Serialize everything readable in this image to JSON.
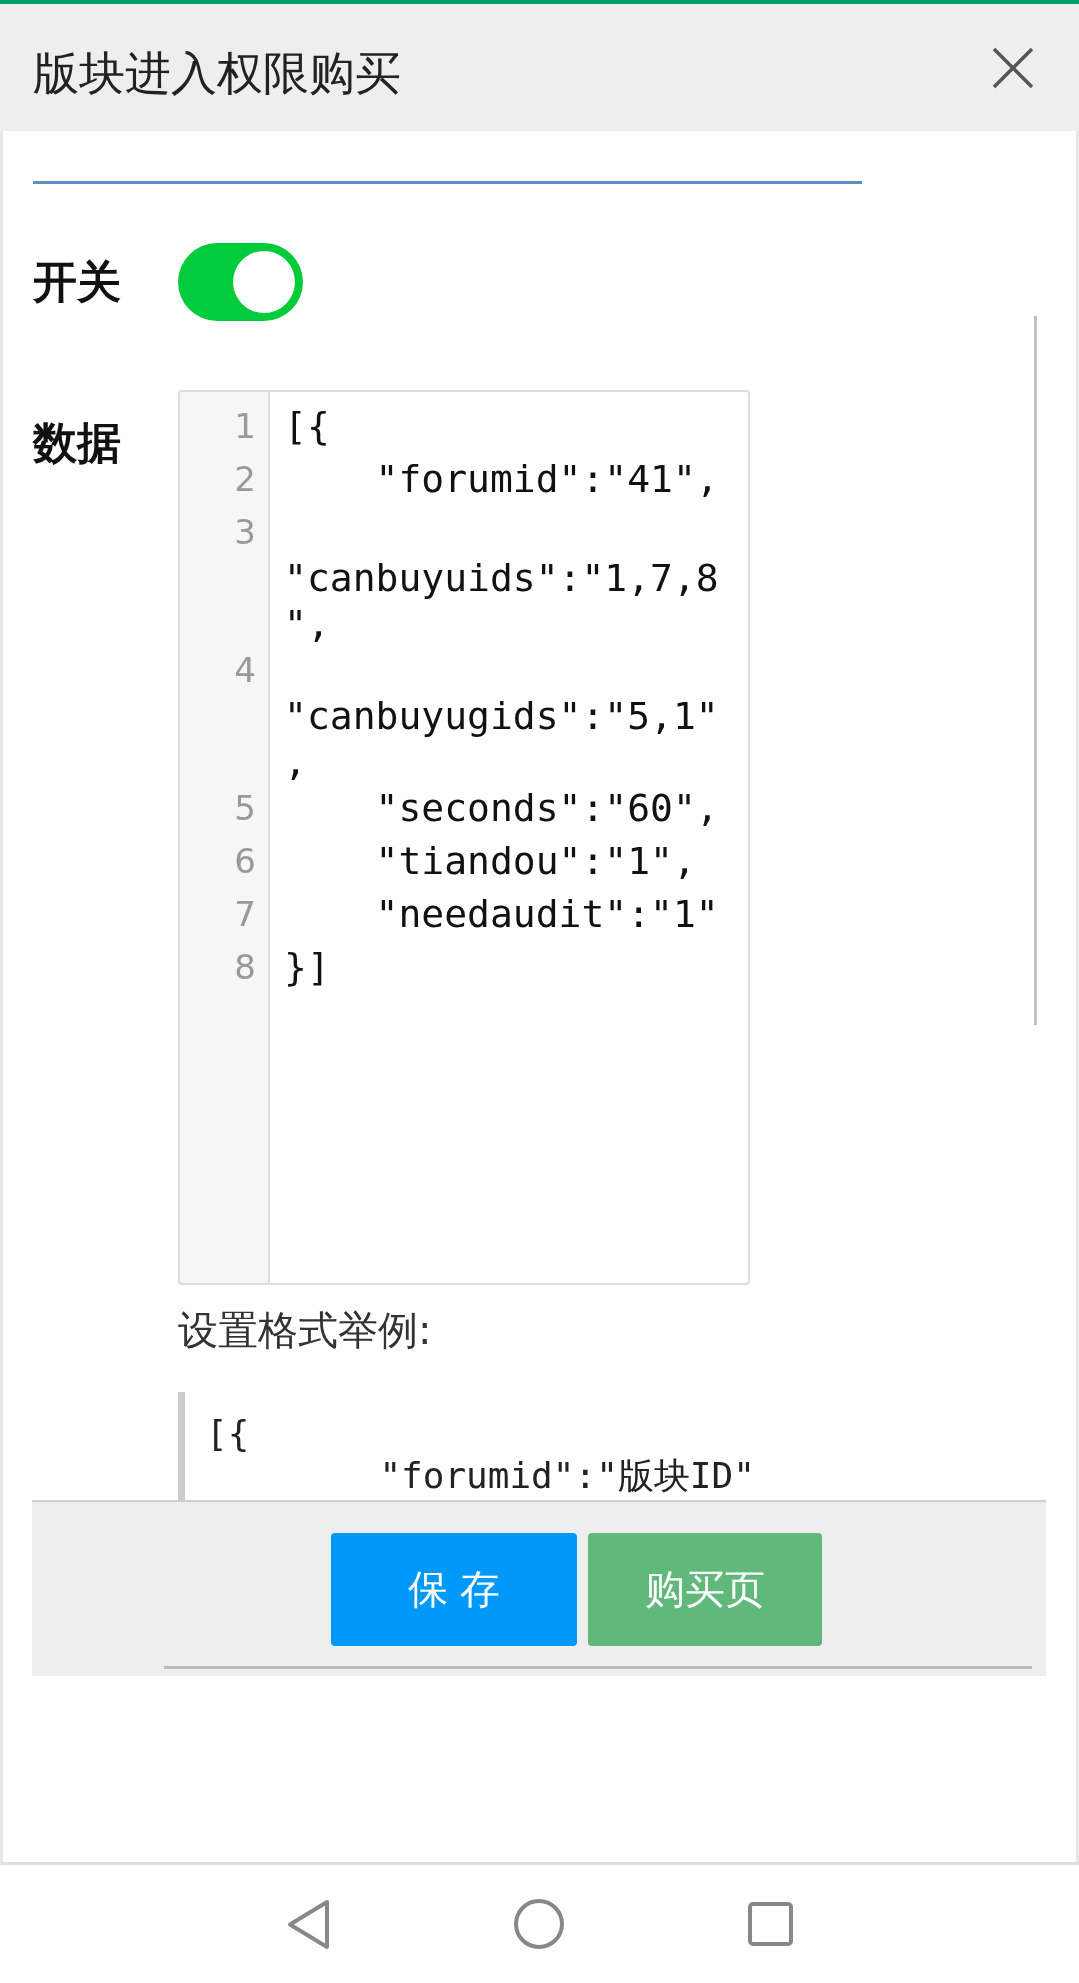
{
  "dialog": {
    "title": "版块进入权限购买"
  },
  "switch": {
    "label": "开关",
    "on": true
  },
  "data": {
    "label": "数据",
    "lines": [
      {
        "number": "1",
        "text": "[{"
      },
      {
        "number": "2",
        "text": "    \"forumid\":\"41\","
      },
      {
        "number": "3",
        "text": "    \"canbuyuids\":\"1,7,8\","
      },
      {
        "number": "4",
        "text": "    \"canbuyugids\":\"5,1\","
      },
      {
        "number": "5",
        "text": "    \"seconds\":\"60\","
      },
      {
        "number": "6",
        "text": "    \"tiandou\":\"1\","
      },
      {
        "number": "7",
        "text": "    \"needaudit\":\"1\""
      },
      {
        "number": "8",
        "text": "}]"
      }
    ]
  },
  "example": {
    "caption": "设置格式举例:",
    "lines": [
      "[{",
      "\t\"forumid\":\"版块ID\""
    ]
  },
  "buttons": [
    {
      "label": "保 存",
      "kind": "primary"
    },
    {
      "label": "购买页",
      "kind": "success"
    }
  ]
}
